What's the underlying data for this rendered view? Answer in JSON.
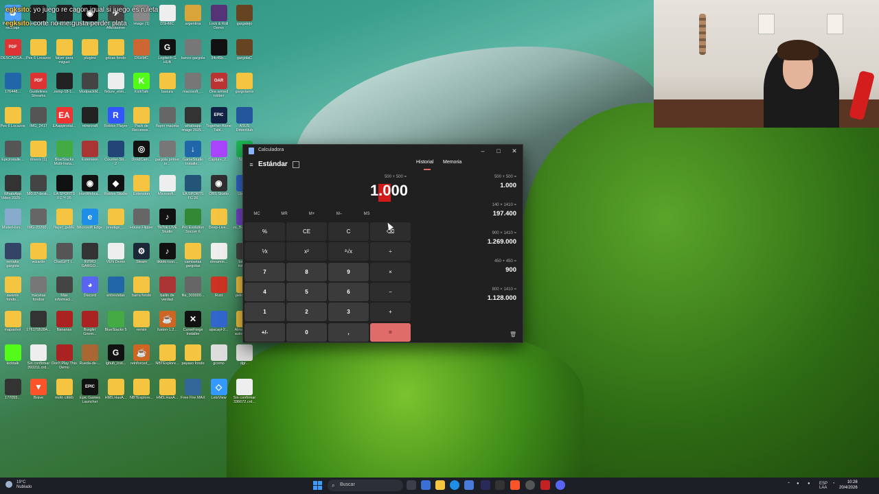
{
  "chat": [
    {
      "user": "egksito",
      "message": "yo juego re cagon igual si juego es ruleta"
    },
    {
      "user": "egksito",
      "message": "corte no me gusta perder plata"
    }
  ],
  "desktop_icons": [
    {
      "label": "Papelera de reciclaje",
      "color": "#4da3ff",
      "glyph": "♻"
    },
    {
      "label": "zemp-14-1...",
      "color": "#222",
      "glyph": ""
    },
    {
      "label": "zemp-18-1...",
      "color": "#222",
      "glyph": ""
    },
    {
      "label": "Iriun Webcam",
      "color": "#111",
      "glyph": "◉"
    },
    {
      "label": "MSI Afterburner",
      "color": "#444",
      "glyph": "✈"
    },
    {
      "label": "image (1)",
      "color": "#888",
      "glyph": ""
    },
    {
      "label": "DSHMC",
      "color": "#eee",
      "glyph": ""
    },
    {
      "label": "argentina",
      "color": "#d9a43a",
      "glyph": ""
    },
    {
      "label": "Lock & Roll Demo",
      "color": "#553377",
      "glyph": ""
    },
    {
      "label": "gargalejo",
      "color": "#664422",
      "glyph": ""
    },
    {
      "label": "DESCARGA...",
      "color": "#d33",
      "glyph": "PDF"
    },
    {
      "label": "Pes 6 Locazos",
      "color": "#f5c542",
      "glyph": ""
    },
    {
      "label": "falyer para miguel",
      "color": "#f5c542",
      "glyph": ""
    },
    {
      "label": "plugins",
      "color": "#f5c542",
      "glyph": ""
    },
    {
      "label": "gricas fondo",
      "color": "#f5c542",
      "glyph": ""
    },
    {
      "label": "DSHMC",
      "color": "#cc6633",
      "glyph": ""
    },
    {
      "label": "Logitech G HUB",
      "color": "#111",
      "glyph": "G"
    },
    {
      "label": "banco gargola",
      "color": "#777",
      "glyph": ""
    },
    {
      "label": "34c45b...",
      "color": "#111",
      "glyph": ""
    },
    {
      "label": "gargolaC",
      "color": "#664422",
      "glyph": ""
    },
    {
      "label": "176448...",
      "color": "#2266aa",
      "glyph": ""
    },
    {
      "label": "Guidelines Streams",
      "color": "#d33",
      "glyph": "PDF"
    },
    {
      "label": "zemp-18-1...",
      "color": "#222",
      "glyph": ""
    },
    {
      "label": "ModpackM...",
      "color": "#444",
      "glyph": ""
    },
    {
      "label": "fixture_elim...",
      "color": "#eee",
      "glyph": ""
    },
    {
      "label": "KickTalk",
      "color": "#53fc18",
      "glyph": "K"
    },
    {
      "label": "basura",
      "color": "#f5c542",
      "glyph": ""
    },
    {
      "label": "macosoft_...",
      "color": "#777",
      "glyph": ""
    },
    {
      "label": "One armed robber",
      "color": "#b33",
      "glyph": "OAR"
    },
    {
      "label": "gargolamix",
      "color": "#f5c542",
      "glyph": ""
    },
    {
      "label": "Pes 6 Locazos",
      "color": "#f5c542",
      "glyph": ""
    },
    {
      "label": "IMG_2417",
      "color": "#555",
      "glyph": ""
    },
    {
      "label": "EAappinstal...",
      "color": "#e33",
      "glyph": "EA"
    },
    {
      "label": "minecraft",
      "color": "#222",
      "glyph": ""
    },
    {
      "label": "Roblox Player",
      "color": "#3355ff",
      "glyph": "R"
    },
    {
      "label": "Pack de Recursos...",
      "color": "#f5c542",
      "glyph": ""
    },
    {
      "label": "flayer maceta",
      "color": "#666",
      "glyph": ""
    },
    {
      "label": "whatsapp image 2025...",
      "color": "#333",
      "glyph": ""
    },
    {
      "label": "Together Alone Tabl...",
      "color": "#112244",
      "glyph": "EPIC"
    },
    {
      "label": "ASUS DriverHub",
      "color": "#225599",
      "glyph": ""
    },
    {
      "label": "Epicinstalle...",
      "color": "#555",
      "glyph": ""
    },
    {
      "label": "drivers (1)",
      "color": "#f5c542",
      "glyph": ""
    },
    {
      "label": "BlueStacks Multi-Insta...",
      "color": "#44aa44",
      "glyph": ""
    },
    {
      "label": "Extension",
      "color": "#aa3333",
      "glyph": ""
    },
    {
      "label": "Counter-Str... 2",
      "color": "#224477",
      "glyph": ""
    },
    {
      "label": "DroidCam...",
      "color": "#111",
      "glyph": "◎"
    },
    {
      "label": "gargola primer in...",
      "color": "#777",
      "glyph": ""
    },
    {
      "label": "GameStudio Installe...",
      "color": "#2266aa",
      "glyph": "↓"
    },
    {
      "label": "Capture_2...",
      "color": "#aa44ff",
      "glyph": ""
    },
    {
      "label": "Spotify",
      "color": "#1db954",
      "glyph": "♫"
    },
    {
      "label": "WhatsApp Video 2025-...",
      "color": "#333",
      "glyph": ""
    },
    {
      "label": "580.97-desk...",
      "color": "#444",
      "glyph": ""
    },
    {
      "label": "EA SPORTS FC™ 26",
      "color": "#111",
      "glyph": ""
    },
    {
      "label": "IriunWebca...",
      "color": "#111",
      "glyph": "◉"
    },
    {
      "label": "Roblox Studio",
      "color": "#111",
      "glyph": "◆"
    },
    {
      "label": "Extension",
      "color": "#f5c542",
      "glyph": ""
    },
    {
      "label": "Microsoft...",
      "color": "#eee",
      "glyph": ""
    },
    {
      "label": "EA SPORTS FC 26",
      "color": "#225577",
      "glyph": ""
    },
    {
      "label": "OBS Studio",
      "color": "#302e31",
      "glyph": "◉"
    },
    {
      "label": "Upscayl",
      "color": "#3366cc",
      "glyph": ""
    },
    {
      "label": "MisterHors...",
      "color": "#88aacc",
      "glyph": ""
    },
    {
      "label": "IMG-20260...",
      "color": "#666",
      "glyph": ""
    },
    {
      "label": "flayer_gaME",
      "color": "#f5c542",
      "glyph": ""
    },
    {
      "label": "Microsoft Edge",
      "color": "#1f8ee8",
      "glyph": "e"
    },
    {
      "label": "prestige_...",
      "color": "#f5c542",
      "glyph": ""
    },
    {
      "label": "House Flipper",
      "color": "#666",
      "glyph": ""
    },
    {
      "label": "TikTok LIVE Studio",
      "color": "#111",
      "glyph": "♪"
    },
    {
      "label": "Pro Evolution Soccer 6",
      "color": "#338833",
      "glyph": ""
    },
    {
      "label": "Deep-Live...",
      "color": "#f5c542",
      "glyph": ""
    },
    {
      "label": "vs_BuildTools",
      "color": "#7744cc",
      "glyph": ""
    },
    {
      "label": "remake gargola",
      "color": "#334466",
      "glyph": ""
    },
    {
      "label": "wizardo",
      "color": "#f5c542",
      "glyph": ""
    },
    {
      "label": "ChatGPT I...",
      "color": "#555",
      "glyph": ""
    },
    {
      "label": "INTRO GARGO...",
      "color": "#333",
      "glyph": ""
    },
    {
      "label": "VEN Demo",
      "color": "#eee",
      "glyph": ""
    },
    {
      "label": "Steam",
      "color": "#1b2838",
      "glyph": "⚙"
    },
    {
      "label": "tiktoki-icon...",
      "color": "#111",
      "glyph": "♪"
    },
    {
      "label": "camisetas gargolas",
      "color": "#f5c542",
      "glyph": ""
    },
    {
      "label": "streamin...",
      "color": "#eee",
      "glyph": ""
    },
    {
      "label": "banner twitch...",
      "color": "#444",
      "glyph": ""
    },
    {
      "label": "awards fondo...",
      "color": "#f5c542",
      "glyph": ""
    },
    {
      "label": "macetas fondos",
      "color": "#777",
      "glyph": ""
    },
    {
      "label": "Más informaci...",
      "color": "#444",
      "glyph": ""
    },
    {
      "label": "Discord",
      "color": "#5865f2",
      "glyph": "◕"
    },
    {
      "label": "entrevistas",
      "color": "#2266aa",
      "glyph": ""
    },
    {
      "label": "barra fondo",
      "color": "#f5c542",
      "glyph": ""
    },
    {
      "label": "ballin de verdad",
      "color": "#a33",
      "glyph": ""
    },
    {
      "label": "file_000000...",
      "color": "#666",
      "glyph": ""
    },
    {
      "label": "Rust",
      "color": "#cc3322",
      "glyph": ""
    },
    {
      "label": "pelicula2...",
      "color": "#f5c542",
      "glyph": ""
    },
    {
      "label": "mapashot",
      "color": "#f5c542",
      "glyph": ""
    },
    {
      "label": "1761795284...",
      "color": "#333",
      "glyph": ""
    },
    {
      "label": "Bananas",
      "color": "#aa2222",
      "glyph": ""
    },
    {
      "label": "Burglin' Gnom...",
      "color": "#aa2222",
      "glyph": ""
    },
    {
      "label": "BlueStacks 5",
      "color": "#44aa44",
      "glyph": ""
    },
    {
      "label": "remini",
      "color": "#f5c542",
      "glyph": ""
    },
    {
      "label": "fusion-1.2...",
      "color": "#cc6622",
      "glyph": "☕"
    },
    {
      "label": "CurseForge Installer",
      "color": "#111",
      "glyph": "✕"
    },
    {
      "label": "upscayl-2...",
      "color": "#3366cc",
      "glyph": ""
    },
    {
      "label": "Almacena... automatic...",
      "color": "#f5c542",
      "glyph": ""
    },
    {
      "label": "kicktalk",
      "color": "#53fc18",
      "glyph": ""
    },
    {
      "label": "Sin confirmar 393211.crd...",
      "color": "#eee",
      "glyph": ""
    },
    {
      "label": "Don't Play This Demo",
      "color": "#aa2222",
      "glyph": ""
    },
    {
      "label": "Rueda-de-...",
      "color": "#aa6633",
      "glyph": ""
    },
    {
      "label": "lghub_inst...",
      "color": "#111",
      "glyph": "G"
    },
    {
      "label": "reinforced_...",
      "color": "#cc6622",
      "glyph": "☕"
    },
    {
      "label": "NBTExplore...",
      "color": "#f5c542",
      "glyph": ""
    },
    {
      "label": "payaso fondo",
      "color": "#f5c542",
      "glyph": ""
    },
    {
      "label": "gcomo",
      "color": "#ddd",
      "glyph": ""
    },
    {
      "label": "dgr...",
      "color": "#ddd",
      "glyph": ""
    },
    {
      "label": "177055...",
      "color": "#333",
      "glyph": ""
    },
    {
      "label": "Brave",
      "color": "#fb542b",
      "glyph": "▼"
    },
    {
      "label": "mofo cititrb",
      "color": "#f5c542",
      "glyph": ""
    },
    {
      "label": "Epic Games Launcher",
      "color": "#111",
      "glyph": "EPIC"
    },
    {
      "label": "HMS.HaxA...",
      "color": "#f5c542",
      "glyph": ""
    },
    {
      "label": "NBTExplore...",
      "color": "#f5c542",
      "glyph": ""
    },
    {
      "label": "HMS.HaxA...",
      "color": "#f5c542",
      "glyph": ""
    },
    {
      "label": "Free Fire MAX",
      "color": "#336699",
      "glyph": ""
    },
    {
      "label": "LetsView",
      "color": "#3399ff",
      "glyph": "◇"
    },
    {
      "label": "Sin confirmar 336672.crd...",
      "color": "#eee",
      "glyph": ""
    }
  ],
  "calculator": {
    "window_title": "Calculadora",
    "window_controls": {
      "minimize": "–",
      "maximize": "□",
      "close": "✕"
    },
    "menu_icon": "≡",
    "mode": "Estándar",
    "expression": "500 + 500 =",
    "result": "1.000",
    "memory_buttons": [
      "MC",
      "MR",
      "M+",
      "M–",
      "MS"
    ],
    "keys": [
      [
        "%",
        "CE",
        "C",
        "⌫"
      ],
      [
        "⅟x",
        "x²",
        "²√x",
        "÷"
      ],
      [
        "7",
        "8",
        "9",
        "×"
      ],
      [
        "4",
        "5",
        "6",
        "−"
      ],
      [
        "1",
        "2",
        "3",
        "+"
      ],
      [
        "+/-",
        "0",
        ",",
        "="
      ]
    ],
    "tabs": {
      "history": "Historial",
      "memory": "Memoria"
    },
    "history": [
      {
        "expression": "500 + 500 =",
        "result": "1.000"
      },
      {
        "expression": "140 × 1410 =",
        "result": "197.400"
      },
      {
        "expression": "900 × 1410 =",
        "result": "1.269.000"
      },
      {
        "expression": "450 + 450 =",
        "result": "900"
      },
      {
        "expression": "800 × 1410 =",
        "result": "1.128.000"
      }
    ],
    "trash_icon": "🗑",
    "accent_color": "#e06c6a"
  },
  "taskbar": {
    "weather_temp": "19°C",
    "weather_desc": "Nublado",
    "search_placeholder": "Buscar",
    "search_icon": "⌕",
    "tray": {
      "lang_1": "ESP",
      "lang_2": "LAA"
    },
    "time": "10:28",
    "date": "20/4/2026"
  }
}
